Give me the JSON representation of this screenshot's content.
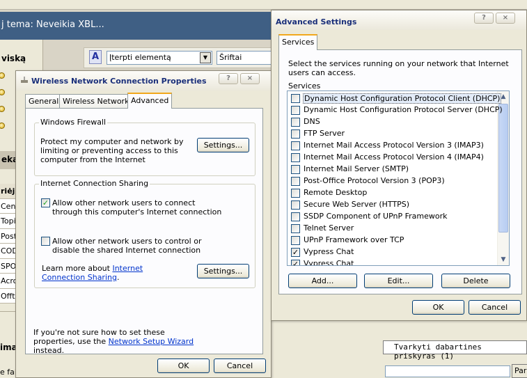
{
  "background": {
    "title_bar_text": "j tema: Neveikia XBL...",
    "left_heading": "viską",
    "left_bar_text": "eka",
    "left_table_header": "riėji",
    "left_rows": [
      "Cent",
      "Topic",
      "Post",
      "COD",
      "SPO",
      "Acro",
      "Offto"
    ],
    "toolbar_combo_value": "Įterpti elementą",
    "toolbar_font_value": "Šriftai",
    "bottom_label": "ima",
    "bottom_text2": "e fai",
    "right_button_text": "Tvarkyti dabartines priskyras (1)",
    "pari_button": "Pari"
  },
  "wncp": {
    "title": "Wireless Network Connection Properties",
    "help_btn": "?",
    "close_btn": "×",
    "tabs": [
      "General",
      "Wireless Networks",
      "Advanced"
    ],
    "firewall": {
      "legend": "Windows Firewall",
      "desc": "Protect my computer and network by limiting or preventing access to this computer from the Internet",
      "settings_btn": "Settings..."
    },
    "ics": {
      "legend": "Internet Connection Sharing",
      "allow_connect": "Allow other network users to connect through this computer's Internet connection",
      "allow_control": "Allow other network users to control or disable the shared Internet connection",
      "learn_prefix": "Learn more about ",
      "learn_link": "Internet Connection Sharing",
      "learn_suffix": ".",
      "settings_btn": "Settings..."
    },
    "footer_text_prefix": "If you're not sure how to set these properties, use the ",
    "footer_link": "Network Setup Wizard",
    "footer_text_suffix": " instead.",
    "ok": "OK",
    "cancel": "Cancel"
  },
  "adv": {
    "title": "Advanced Settings",
    "help_btn": "?",
    "close_btn": "×",
    "tab": "Services",
    "intro": "Select the services running on your network that Internet users can access.",
    "services_label": "Services",
    "services": [
      {
        "label": "Dynamic Host Configuration Protocol Client (DHCP)",
        "checked": false,
        "selected": true
      },
      {
        "label": "Dynamic Host Configuration Protocol Server (DHCP)",
        "checked": false
      },
      {
        "label": "DNS",
        "checked": false
      },
      {
        "label": "FTP Server",
        "checked": false
      },
      {
        "label": "Internet Mail Access Protocol Version 3 (IMAP3)",
        "checked": false
      },
      {
        "label": "Internet Mail Access Protocol Version 4 (IMAP4)",
        "checked": false
      },
      {
        "label": "Internet Mail Server (SMTP)",
        "checked": false
      },
      {
        "label": "Post-Office Protocol Version 3 (POP3)",
        "checked": false
      },
      {
        "label": "Remote Desktop",
        "checked": false
      },
      {
        "label": "Secure Web Server (HTTPS)",
        "checked": false
      },
      {
        "label": "SSDP Component of UPnP Framework",
        "checked": false
      },
      {
        "label": "Telnet Server",
        "checked": false
      },
      {
        "label": "UPnP Framework over TCP",
        "checked": false
      },
      {
        "label": "Vypress Chat",
        "checked": true
      },
      {
        "label": "Vypress Chat",
        "checked": true
      }
    ],
    "add_btn": "Add...",
    "edit_btn": "Edit...",
    "delete_btn": "Delete",
    "ok": "OK",
    "cancel": "Cancel"
  }
}
